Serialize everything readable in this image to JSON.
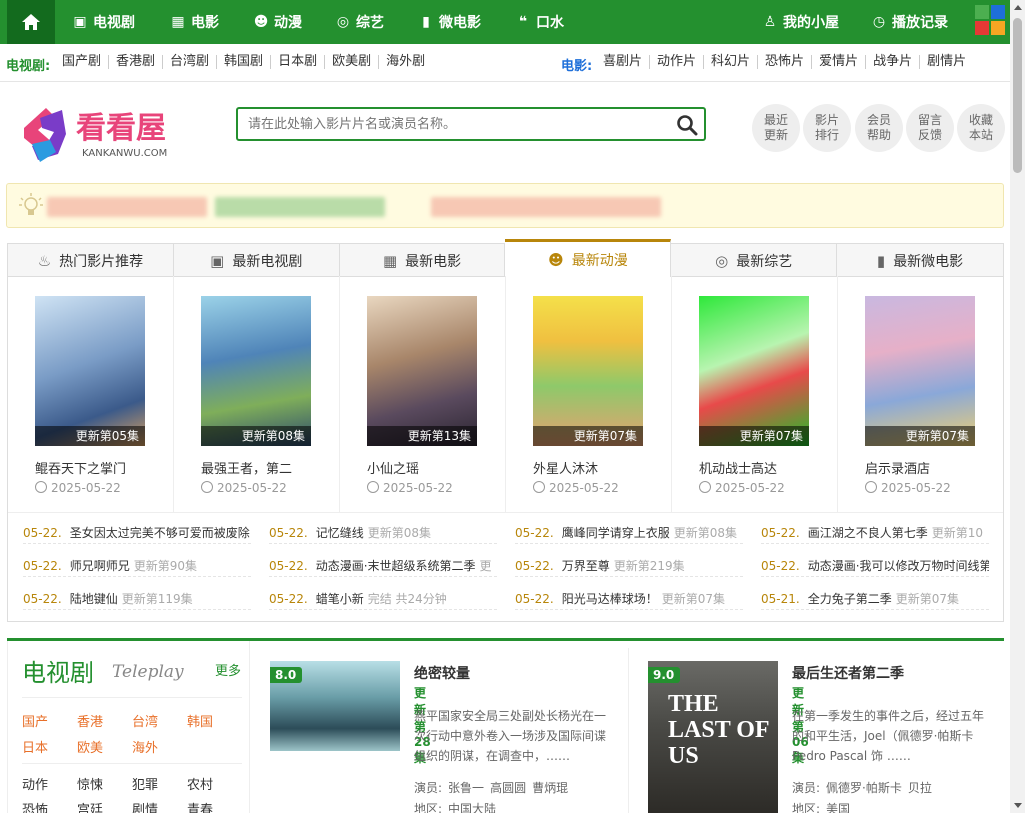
{
  "nav": {
    "items": [
      {
        "label": "电视剧",
        "icon": "tv-icon"
      },
      {
        "label": "电影",
        "icon": "film-icon"
      },
      {
        "label": "动漫",
        "icon": "anime-icon"
      },
      {
        "label": "综艺",
        "icon": "variety-icon"
      },
      {
        "label": "微电影",
        "icon": "micro-film-icon"
      },
      {
        "label": "口水",
        "icon": "chat-icon"
      }
    ],
    "user": "我的小屋",
    "history": "播放记录",
    "colors": [
      "#4caf50",
      "#1e6fd9",
      "#e53935",
      "#f5a623"
    ]
  },
  "subnav": {
    "tv_label": "电视剧:",
    "tv_items": [
      "国产剧",
      "香港剧",
      "台湾剧",
      "韩国剧",
      "日本剧",
      "欧美剧",
      "海外剧"
    ],
    "movie_label": "电影:",
    "movie_items": [
      "喜剧片",
      "动作片",
      "科幻片",
      "恐怖片",
      "爱情片",
      "战争片",
      "剧情片"
    ]
  },
  "logo": {
    "main": "看看屋",
    "domain": "KANKANWU.COM"
  },
  "search": {
    "placeholder": "请在此处输入影片片名或演员名称。"
  },
  "quick": [
    {
      "l1": "最近",
      "l2": "更新"
    },
    {
      "l1": "影片",
      "l2": "排行"
    },
    {
      "l1": "会员",
      "l2": "帮助"
    },
    {
      "l1": "留言",
      "l2": "反馈"
    },
    {
      "l1": "收藏",
      "l2": "本站"
    }
  ],
  "tabs": [
    {
      "label": "热门影片推荐",
      "icon": "flame-icon"
    },
    {
      "label": "最新电视剧",
      "icon": "tv-icon"
    },
    {
      "label": "最新电影",
      "icon": "film-icon"
    },
    {
      "label": "最新动漫",
      "icon": "anime-icon"
    },
    {
      "label": "最新综艺",
      "icon": "variety-icon"
    },
    {
      "label": "最新微电影",
      "icon": "micro-film-icon"
    }
  ],
  "active_tab": 3,
  "cards": [
    {
      "name": "鲲吞天下之掌门",
      "ep": "更新第05集",
      "date": "2025-05-22"
    },
    {
      "name": "最强王者，第二",
      "ep": "更新第08集",
      "date": "2025-05-22"
    },
    {
      "name": "小仙之瑶",
      "ep": "更新第13集",
      "date": "2025-05-22"
    },
    {
      "name": "外星人沐沐",
      "ep": "更新第07集",
      "date": "2025-05-22"
    },
    {
      "name": "机动战士高达",
      "ep": "更新第07集",
      "date": "2025-05-22"
    },
    {
      "name": "启示录酒店",
      "ep": "更新第07集",
      "date": "2025-05-22"
    }
  ],
  "updates": [
    [
      {
        "date": "05-22.",
        "title": "圣女因太过完美不够可爱而被废除",
        "status": ""
      },
      {
        "date": "05-22.",
        "title": "师兄啊师兄",
        "status": "更新第90集"
      },
      {
        "date": "05-22.",
        "title": "陆地键仙",
        "status": "更新第119集"
      }
    ],
    [
      {
        "date": "05-22.",
        "title": "记忆缝线",
        "status": "更新第08集"
      },
      {
        "date": "05-22.",
        "title": "动态漫画·末世超级系统第二季",
        "status": "更"
      },
      {
        "date": "05-22.",
        "title": "蜡笔小新",
        "status": "完结 共24分钟"
      }
    ],
    [
      {
        "date": "05-22.",
        "title": "鹰峰同学请穿上衣服",
        "status": "更新第08集"
      },
      {
        "date": "05-22.",
        "title": "万界至尊",
        "status": "更新第219集"
      },
      {
        "date": "05-22.",
        "title": "阳光马达棒球场！",
        "status": "更新第07集"
      }
    ],
    [
      {
        "date": "05-22.",
        "title": "画江湖之不良人第七季",
        "status": "更新第10"
      },
      {
        "date": "05-22.",
        "title": "动态漫画·我可以修改万物时间线第",
        "status": ""
      },
      {
        "date": "05-21.",
        "title": "全力兔子第二季",
        "status": "更新第07集"
      }
    ]
  ],
  "section": {
    "title": "电视剧",
    "subtitle": "Teleplay",
    "more": "更多",
    "regions": [
      "国产",
      "香港",
      "台湾",
      "韩国",
      "日本",
      "欧美",
      "海外"
    ],
    "genres": [
      "动作",
      "惊悚",
      "犯罪",
      "农村",
      "恐怖",
      "宫廷",
      "剧情",
      "青春"
    ]
  },
  "recs": [
    {
      "score": "8.0",
      "title": "绝密较量",
      "ep": "更新第28集",
      "desc": "燕平国家安全局三处副处长杨光在一次行动中意外卷入一场涉及国际间谍组织的阴谋，在调查中，……",
      "actors_label": "演员:",
      "actors": [
        "张鲁一",
        "高圆圆",
        "曹炳琨"
      ],
      "region_label": "地区:",
      "region": "中国大陆"
    },
    {
      "score": "9.0",
      "title": "最后生还者第二季",
      "ep": "更新第06集",
      "desc": "在第一季发生的事件之后，经过五年的和平生活，Joel（佩德罗·帕斯卡 Pedro Pascal 饰 ……",
      "actors_label": "演员:",
      "actors": [
        "佩德罗·帕斯卡",
        "贝拉"
      ],
      "region_label": "地区:",
      "region": "美国",
      "poster_text": "THE LAST OF US"
    }
  ]
}
